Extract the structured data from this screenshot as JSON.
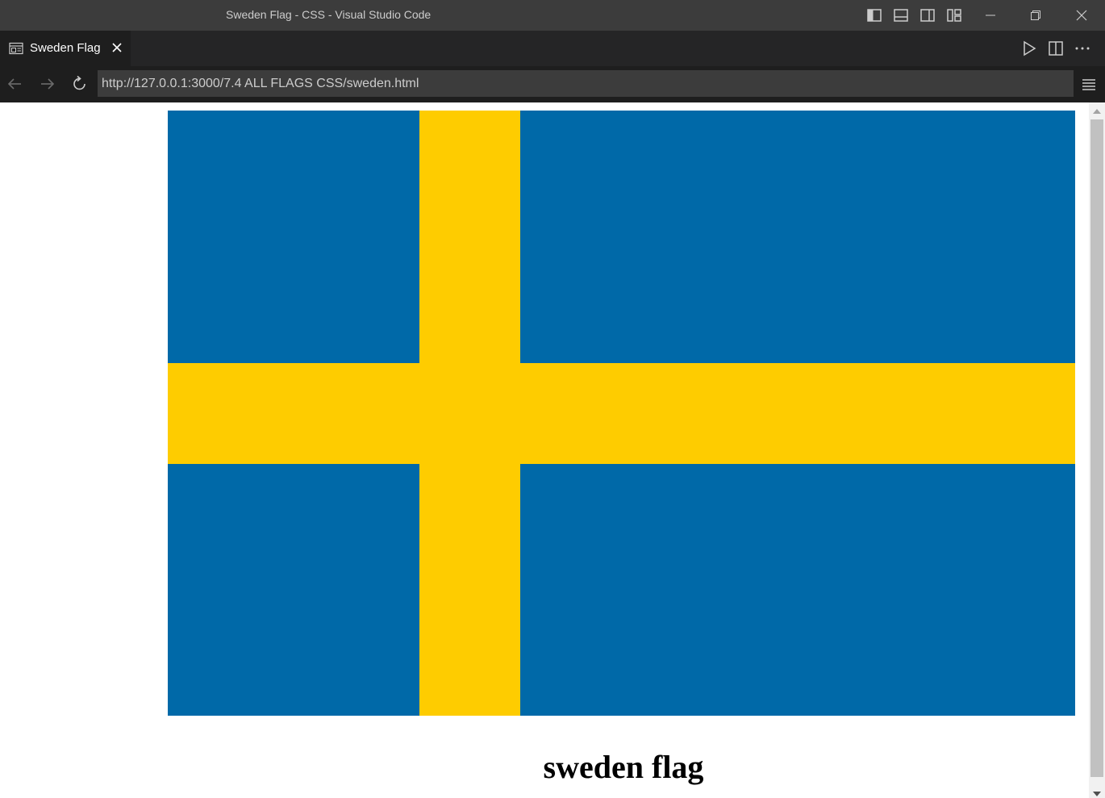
{
  "window": {
    "title": "Sweden Flag - CSS - Visual Studio Code"
  },
  "editor_tab": {
    "label": "Sweden Flag",
    "icon": "preview-icon",
    "close_icon": "close-icon"
  },
  "browser": {
    "url": "http://127.0.0.1:3000/7.4 ALL FLAGS CSS/sweden.html"
  },
  "page": {
    "caption": "sweden flag"
  },
  "colors": {
    "flag_blue": "#0069a8",
    "flag_yellow": "#fecc00",
    "titlebar": "#3c3c3c",
    "tabbar": "#252526",
    "editor_bg": "#1e1e1e"
  }
}
